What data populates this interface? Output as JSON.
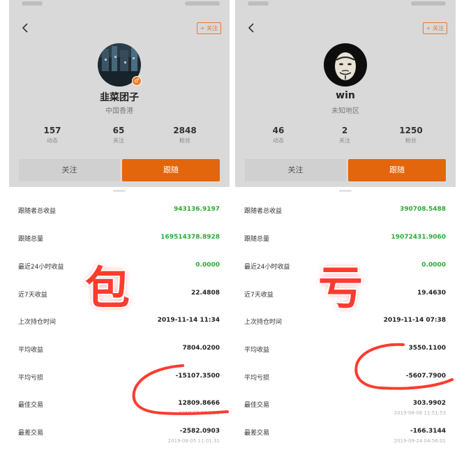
{
  "left": {
    "follow_tag": "+ 关注",
    "username": "韭菜团子",
    "location": "中国香港",
    "stats": [
      {
        "value": "157",
        "label": "动态"
      },
      {
        "value": "65",
        "label": "关注"
      },
      {
        "value": "2848",
        "label": "粉丝"
      }
    ],
    "buttons": {
      "follow": "关注",
      "copy": "跟随"
    },
    "rows": [
      {
        "label": "跟随者总收益",
        "value": "943136.9197",
        "sub": ""
      },
      {
        "label": "跟随总量",
        "value": "169514378.8928",
        "sub": ""
      },
      {
        "label": "最近24小时收益",
        "value": "0.0000",
        "sub": ""
      },
      {
        "label": "近7天收益",
        "value": "22.4808",
        "sub": ""
      },
      {
        "label": "上次持仓时间",
        "value": "2019-11-14 11:34",
        "sub": ""
      },
      {
        "label": "平均收益",
        "value": "7804.0200",
        "sub": ""
      },
      {
        "label": "平均亏损",
        "value": "-15107.3500",
        "sub": ""
      },
      {
        "label": "最佳交易",
        "value": "12809.8666",
        "sub": "2019-08-21 11:2"
      },
      {
        "label": "最差交易",
        "value": "-2582.0903",
        "sub": "2019-08-05 11:01:31"
      }
    ],
    "overlay_char": "包"
  },
  "right": {
    "follow_tag": "+ 关注",
    "username": "win",
    "location": "未知地区",
    "stats": [
      {
        "value": "46",
        "label": "动态"
      },
      {
        "value": "2",
        "label": "关注"
      },
      {
        "value": "1250",
        "label": "粉丝"
      }
    ],
    "buttons": {
      "follow": "关注",
      "copy": "跟随"
    },
    "rows": [
      {
        "label": "跟随者总收益",
        "value": "390708.5488",
        "sub": ""
      },
      {
        "label": "跟随总量",
        "value": "19072431.9060",
        "sub": ""
      },
      {
        "label": "最近24小时收益",
        "value": "0.0000",
        "sub": ""
      },
      {
        "label": "近7天收益",
        "value": "19.4630",
        "sub": ""
      },
      {
        "label": "上次持仓时间",
        "value": "2019-11-14 07:38",
        "sub": ""
      },
      {
        "label": "平均收益",
        "value": "3550.1100",
        "sub": ""
      },
      {
        "label": "平均亏损",
        "value": "-5607.7900",
        "sub": ""
      },
      {
        "label": "最佳交易",
        "value": "303.9902",
        "sub": "2019-08-06 11:51:53"
      },
      {
        "label": "最差交易",
        "value": "-166.3144",
        "sub": "2019-09-24 04:56:01"
      }
    ],
    "overlay_char": "亏"
  },
  "colors": {
    "accent": "#e3660c",
    "positive": "#2daa34",
    "annotation": "#ff3b2f",
    "header_bg": "#d9d9d9"
  },
  "icons": [
    "back-icon",
    "verified-icon",
    "avatar"
  ]
}
